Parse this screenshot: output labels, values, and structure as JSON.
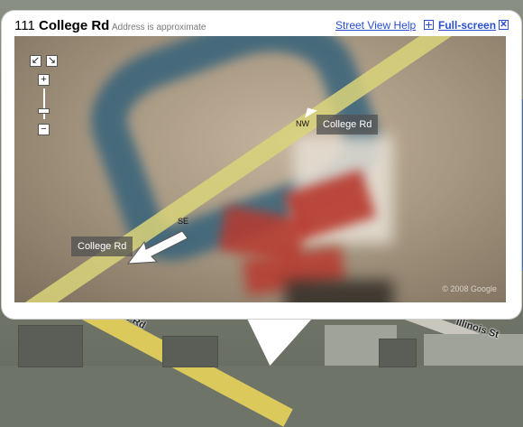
{
  "popup": {
    "number": "111",
    "street": "College Rd",
    "approx_note": "Address is approximate",
    "help_link": "Street View Help",
    "fullscreen_link": "Full-screen"
  },
  "streetview": {
    "labels": {
      "forward": {
        "direction": "NW",
        "road": "College Rd"
      },
      "back": {
        "direction": "SE",
        "road": "College Rd"
      }
    },
    "controls": {
      "pan_left": "↙",
      "pan_right": "↘",
      "zoom_in": "+",
      "zoom_out": "−"
    },
    "copyright": "© 2008 Google"
  },
  "map": {
    "road_labels": [
      "e Rd",
      "Illinois St"
    ]
  },
  "icons": {
    "fullscreen": "fullscreen-icon",
    "close": "close-icon",
    "arrow": "arrow-icon"
  },
  "colors": {
    "link": "#2a4fd1",
    "road": "#e8d35a"
  }
}
